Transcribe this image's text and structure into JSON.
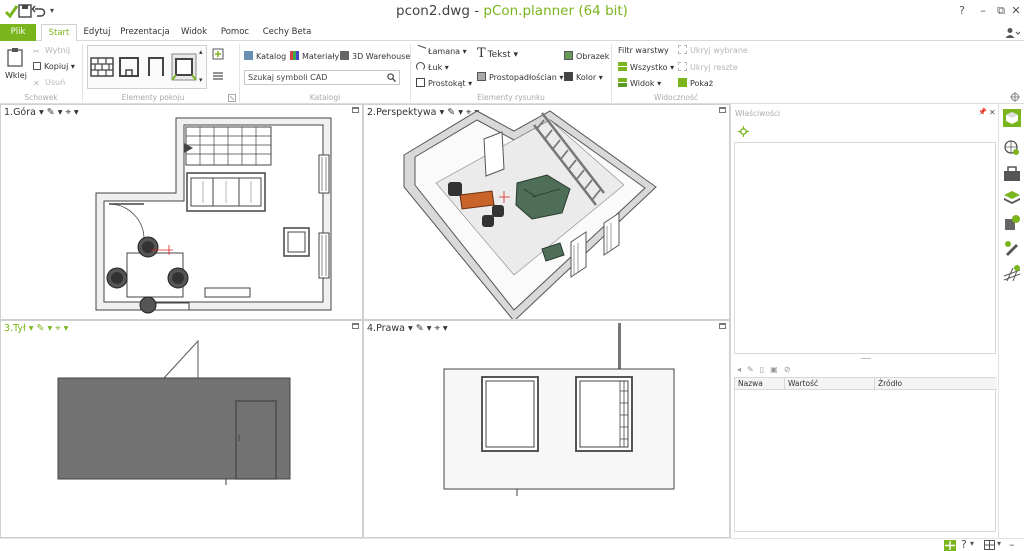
{
  "window": {
    "filename": "pcon2.dwg",
    "separator": " - ",
    "app": "pCon.planner (64 bit)",
    "help": "?"
  },
  "tabs": [
    "Plik",
    "Start",
    "Edytuj",
    "Prezentacja",
    "Widok",
    "Pomoc",
    "Cechy Beta"
  ],
  "ribbon": {
    "clipboard": {
      "paste": "Wklej",
      "cut": "Wytnij",
      "copy": "Kopiuj",
      "delete": "Usuń",
      "group": "Schowek"
    },
    "room": {
      "group": "Elementy pokoju"
    },
    "catalogs": {
      "catalog": "Katalog",
      "materials": "Materiały",
      "warehouse": "3D Warehouse",
      "search_placeholder": "Szukaj symboli CAD",
      "group": "Katalogi"
    },
    "drawing": {
      "polyline": "Łamana",
      "arc": "Łuk",
      "rectangle": "Prostokąt",
      "text": "Tekst",
      "cuboid": "Prostopadłościan",
      "image": "Obrazek",
      "color": "Kolor",
      "group": "Elementy rysunku"
    },
    "visibility": {
      "layer_filter": "Filtr warstwy",
      "all": "Wszystko",
      "view": "Widok",
      "hide_selected": "Ukryj wybrane",
      "hide_rest": "Ukryj reszte",
      "show": "Pokaż",
      "group": "Widoczność"
    }
  },
  "viewports": [
    {
      "label": "1.Góra"
    },
    {
      "label": "2.Perspektywa"
    },
    {
      "label": "3.Tył"
    },
    {
      "label": "4.Prawa"
    }
  ],
  "properties": {
    "title": "Właściwości",
    "columns": [
      "Nazwa",
      "Wartość",
      "Źródło"
    ]
  },
  "colors": {
    "accent": "#7ab51d",
    "wall_dark": "#727272",
    "sofa": "#4f6e58",
    "desk": "#c8632a"
  }
}
